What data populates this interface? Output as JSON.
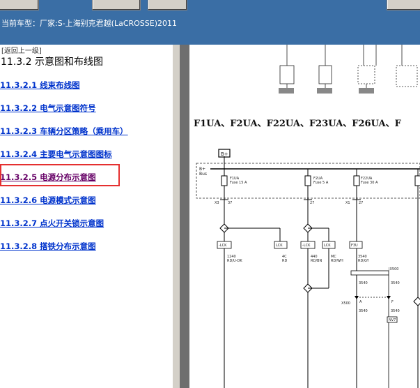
{
  "header": {
    "current_model": "当前车型：厂家:S-上海别克君越(LaCROSSE)2011"
  },
  "left_panel": {
    "back_link": "[返回上一级]",
    "section_title": "11.3.2 示意图和布线图",
    "nav_items": [
      {
        "label": "11.3.2.1 线束布线图",
        "visited": false
      },
      {
        "label": "11.3.2.2 电气示意图符号",
        "visited": false
      },
      {
        "label": "11.3.2.3 车辆分区策略（乘用车）",
        "visited": false
      },
      {
        "label": "11.3.2.4 主要电气示意图图标",
        "visited": false
      },
      {
        "label": "11.3.2.5 电源分布示意图",
        "visited": true,
        "highlighted": true
      },
      {
        "label": "11.3.2.6 电源模式示意图",
        "visited": false
      },
      {
        "label": "11.3.2.7 点火开关锁示意图",
        "visited": false
      },
      {
        "label": "11.3.2.8 搭铁分布示意图",
        "visited": false
      }
    ]
  },
  "diagram": {
    "fuse_heading": "F1UA、F2UA、F22UA、F23UA、F26UA、F",
    "bplus_box": "B+",
    "bus_label": "B+\nBus",
    "fuses": [
      {
        "name": "F1UA",
        "rating": "Fuse 15 A",
        "pin_left": "X3",
        "pin": "37"
      },
      {
        "name": "F2UA",
        "rating": "Fuse 5 A",
        "pin": "27"
      },
      {
        "name": "F22UA",
        "rating": "Fuse 30 A",
        "pin": "X1",
        "pin2": "27"
      }
    ],
    "connectors": [
      "-LCK",
      "LCK",
      "-LCK",
      "LCK",
      "F3U"
    ],
    "wire_labels": [
      {
        "id": "1240",
        "color": "RD/U-DK"
      },
      {
        "id": "4C",
        "color": "RD"
      },
      {
        "id": "440",
        "color": "RD/BN"
      },
      {
        "id": "MC",
        "color": "RD/WH"
      },
      {
        "id": "3540",
        "color": "RD/GY"
      }
    ],
    "splice_labels": [
      "JX500",
      "X500",
      "A",
      "F",
      "NV7"
    ],
    "highlight_color": "#e53030"
  }
}
